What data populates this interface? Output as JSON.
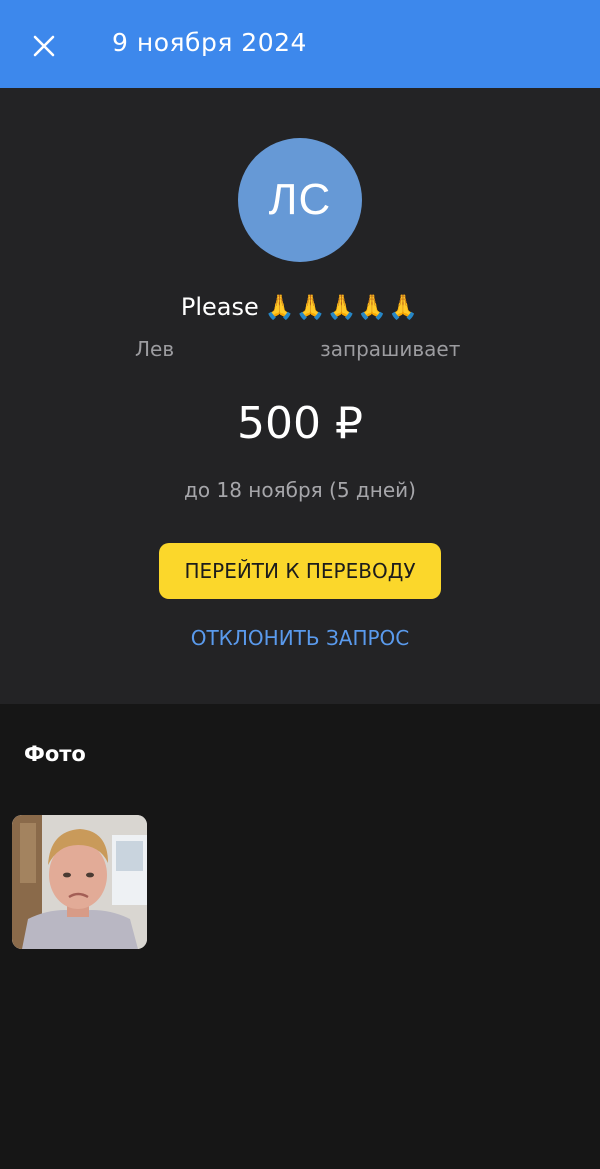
{
  "header": {
    "close_icon": "close-icon",
    "title": "9 ноября 2024"
  },
  "request": {
    "avatar_initials": "ЛС",
    "message": "Please",
    "message_emoji": "🙏🙏🙏🙏🙏",
    "requester_name": "Лев",
    "requester_action": "запрашивает",
    "amount": "500 ₽",
    "deadline": "до 18 ноября (5 дней)",
    "pay_button_label": "ПЕРЕЙТИ К ПЕРЕВОДУ",
    "decline_label": "ОТКЛОНИТЬ ЗАПРОС"
  },
  "photos": {
    "heading": "Фото"
  },
  "colors": {
    "header_bg": "#3d88ec",
    "card_bg": "#232325",
    "page_bg": "#161616",
    "avatar_bg": "#6699d6",
    "pay_button_bg": "#fbd72b",
    "decline_link": "#5a9aec"
  }
}
